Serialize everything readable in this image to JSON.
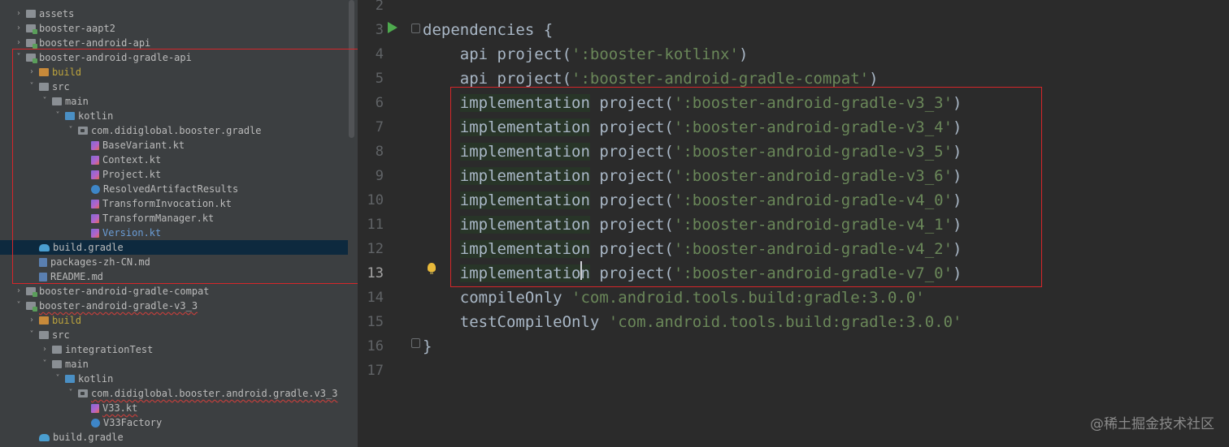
{
  "project_tree": {
    "rows": [
      {
        "label": "assets",
        "arrow": "right",
        "icon": "folder-icon",
        "style": "normal"
      },
      {
        "label": "booster-aapt2",
        "arrow": "right",
        "icon": "module-icon",
        "style": "normal"
      },
      {
        "label": "booster-android-api",
        "arrow": "right",
        "icon": "module-icon",
        "style": "normal"
      },
      {
        "label": "booster-android-gradle-api",
        "arrow": "down",
        "icon": "module-icon",
        "style": "normal"
      },
      {
        "label": "build",
        "arrow": "right",
        "icon": "orange-folder-icon",
        "style": "build"
      },
      {
        "label": "src",
        "arrow": "down",
        "icon": "folder-icon",
        "style": "normal"
      },
      {
        "label": "main",
        "arrow": "down",
        "icon": "folder-icon",
        "style": "normal"
      },
      {
        "label": "kotlin",
        "arrow": "down",
        "icon": "blue-folder-icon",
        "style": "normal"
      },
      {
        "label": "com.didiglobal.booster.gradle",
        "arrow": "down",
        "icon": "package-icon",
        "style": "normal"
      },
      {
        "label": "BaseVariant.kt",
        "arrow": "none",
        "icon": "kotlin-file-icon",
        "style": "normal"
      },
      {
        "label": "Context.kt",
        "arrow": "none",
        "icon": "kotlin-file-icon",
        "style": "normal"
      },
      {
        "label": "Project.kt",
        "arrow": "none",
        "icon": "kotlin-file-icon",
        "style": "normal"
      },
      {
        "label": "ResolvedArtifactResults",
        "arrow": "none",
        "icon": "kotlin-class-icon",
        "style": "normal"
      },
      {
        "label": "TransformInvocation.kt",
        "arrow": "none",
        "icon": "kotlin-file-icon",
        "style": "normal"
      },
      {
        "label": "TransformManager.kt",
        "arrow": "none",
        "icon": "kotlin-file-icon",
        "style": "normal"
      },
      {
        "label": "Version.kt",
        "arrow": "none",
        "icon": "kotlin-file-icon",
        "style": "modified"
      },
      {
        "label": "build.gradle",
        "arrow": "none",
        "icon": "gradle-icon",
        "style": "normal",
        "selected": true
      },
      {
        "label": "packages-zh-CN.md",
        "arrow": "none",
        "icon": "markdown-icon",
        "style": "normal"
      },
      {
        "label": "README.md",
        "arrow": "none",
        "icon": "markdown-icon",
        "style": "normal"
      },
      {
        "label": "booster-android-gradle-compat",
        "arrow": "right",
        "icon": "module-icon",
        "style": "normal"
      },
      {
        "label": "booster-android-gradle-v3_3",
        "arrow": "down",
        "icon": "module-icon",
        "style": "error"
      },
      {
        "label": "build",
        "arrow": "right",
        "icon": "orange-folder-icon",
        "style": "build"
      },
      {
        "label": "src",
        "arrow": "down",
        "icon": "folder-icon",
        "style": "normal"
      },
      {
        "label": "integrationTest",
        "arrow": "right",
        "icon": "folder-icon",
        "style": "normal"
      },
      {
        "label": "main",
        "arrow": "down",
        "icon": "folder-icon",
        "style": "normal"
      },
      {
        "label": "kotlin",
        "arrow": "down",
        "icon": "blue-folder-icon",
        "style": "normal"
      },
      {
        "label": "com.didiglobal.booster.android.gradle.v3_3",
        "arrow": "down",
        "icon": "package-icon",
        "style": "error"
      },
      {
        "label": "V33.kt",
        "arrow": "none",
        "icon": "kotlin-file-icon",
        "style": "error"
      },
      {
        "label": "V33Factory",
        "arrow": "none",
        "icon": "kotlin-class-icon",
        "style": "normal"
      },
      {
        "label": "build.gradle",
        "arrow": "none",
        "icon": "gradle-icon",
        "style": "normal"
      }
    ]
  },
  "editor": {
    "line_numbers": [
      "2",
      "3",
      "4",
      "5",
      "6",
      "7",
      "8",
      "9",
      "10",
      "11",
      "12",
      "13",
      "14",
      "15",
      "16",
      "17"
    ],
    "current_line": "13",
    "lines": [
      {
        "parts": []
      },
      {
        "parts": [
          {
            "t": "dependencies {",
            "c": "plain"
          }
        ]
      },
      {
        "parts": [
          {
            "t": "    api project(",
            "c": "plain"
          },
          {
            "t": "':booster-kotlinx'",
            "c": "str"
          },
          {
            "t": ")",
            "c": "plain"
          }
        ]
      },
      {
        "parts": [
          {
            "t": "    api project(",
            "c": "plain"
          },
          {
            "t": "':booster-android-gradle-compat'",
            "c": "str"
          },
          {
            "t": ")",
            "c": "plain"
          }
        ]
      },
      {
        "parts": [
          {
            "t": "    ",
            "c": "plain"
          },
          {
            "t": "implementation",
            "c": "impl"
          },
          {
            "t": " project(",
            "c": "plain"
          },
          {
            "t": "':booster-android-gradle-v3_3'",
            "c": "str"
          },
          {
            "t": ")",
            "c": "plain"
          }
        ]
      },
      {
        "parts": [
          {
            "t": "    ",
            "c": "plain"
          },
          {
            "t": "implementation",
            "c": "impl"
          },
          {
            "t": " project(",
            "c": "plain"
          },
          {
            "t": "':booster-android-gradle-v3_4'",
            "c": "str"
          },
          {
            "t": ")",
            "c": "plain"
          }
        ]
      },
      {
        "parts": [
          {
            "t": "    ",
            "c": "plain"
          },
          {
            "t": "implementation",
            "c": "impl"
          },
          {
            "t": " project(",
            "c": "plain"
          },
          {
            "t": "':booster-android-gradle-v3_5'",
            "c": "str"
          },
          {
            "t": ")",
            "c": "plain"
          }
        ]
      },
      {
        "parts": [
          {
            "t": "    ",
            "c": "plain"
          },
          {
            "t": "implementation",
            "c": "impl"
          },
          {
            "t": " project(",
            "c": "plain"
          },
          {
            "t": "':booster-android-gradle-v3_6'",
            "c": "str"
          },
          {
            "t": ")",
            "c": "plain"
          }
        ]
      },
      {
        "parts": [
          {
            "t": "    ",
            "c": "plain"
          },
          {
            "t": "implementation",
            "c": "impl"
          },
          {
            "t": " project(",
            "c": "plain"
          },
          {
            "t": "':booster-android-gradle-v4_0'",
            "c": "str"
          },
          {
            "t": ")",
            "c": "plain"
          }
        ]
      },
      {
        "parts": [
          {
            "t": "    ",
            "c": "plain"
          },
          {
            "t": "implementation",
            "c": "impl"
          },
          {
            "t": " project(",
            "c": "plain"
          },
          {
            "t": "':booster-android-gradle-v4_1'",
            "c": "str"
          },
          {
            "t": ")",
            "c": "plain"
          }
        ]
      },
      {
        "parts": [
          {
            "t": "    ",
            "c": "plain"
          },
          {
            "t": "implementation",
            "c": "impl"
          },
          {
            "t": " project(",
            "c": "plain"
          },
          {
            "t": "':booster-android-gradle-v4_2'",
            "c": "str"
          },
          {
            "t": ")",
            "c": "plain"
          }
        ]
      },
      {
        "parts": [
          {
            "t": "    ",
            "c": "plain"
          },
          {
            "t": "implementation",
            "c": "impl"
          },
          {
            "t": " project(",
            "c": "plain"
          },
          {
            "t": "':booster-android-gradle-v7_0'",
            "c": "str"
          },
          {
            "t": ")",
            "c": "plain"
          }
        ]
      },
      {
        "parts": [
          {
            "t": "    compileOnly ",
            "c": "plain"
          },
          {
            "t": "'com.android.tools.build:gradle:3.0.0'",
            "c": "str"
          }
        ]
      },
      {
        "parts": [
          {
            "t": "    testCompileOnly ",
            "c": "plain"
          },
          {
            "t": "'com.android.tools.build:gradle:3.0.0'",
            "c": "str"
          }
        ]
      },
      {
        "parts": [
          {
            "t": "}",
            "c": "plain"
          }
        ]
      },
      {
        "parts": []
      }
    ]
  },
  "watermark": "@稀土掘金技术社区",
  "colors": {
    "annotation_box": "#d6262a",
    "string": "#6a8759",
    "code_text": "#a9b7c6",
    "sidebar_bg": "#3c3f41",
    "editor_bg": "#2b2b2b"
  }
}
